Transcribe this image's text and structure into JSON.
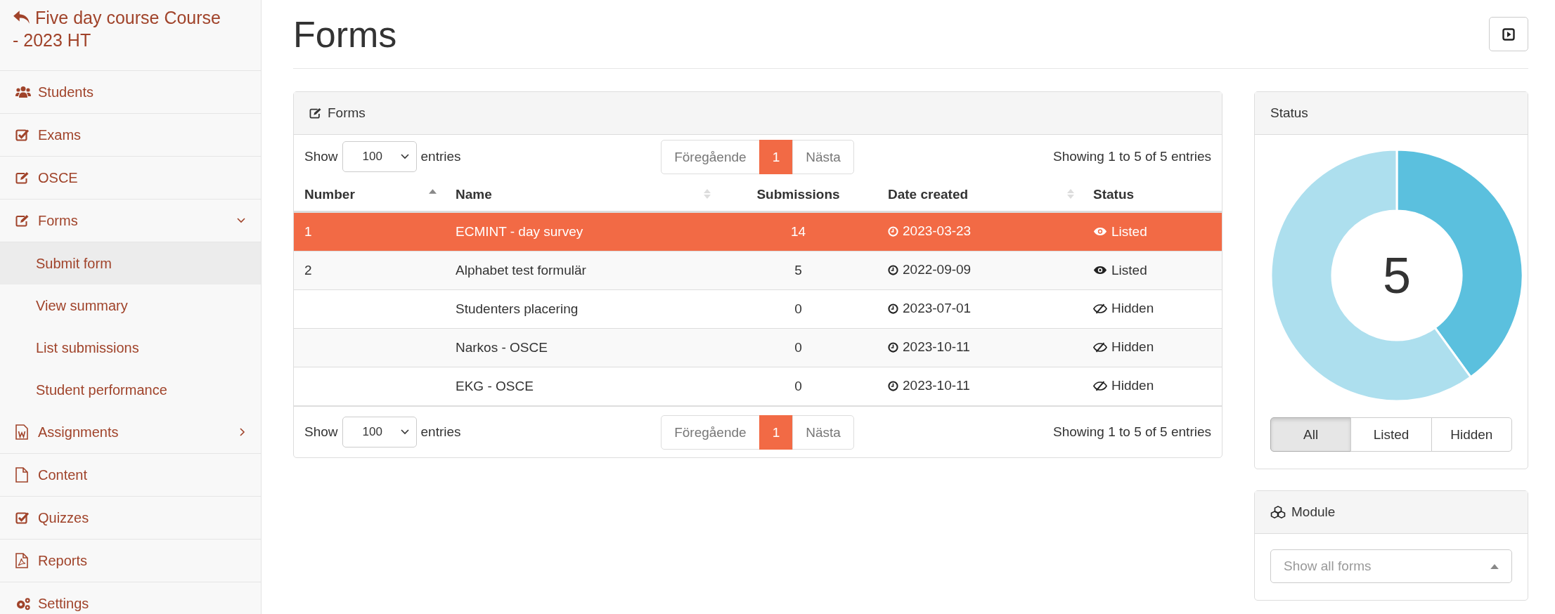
{
  "sidebar": {
    "back_title": "Five day course Course - 2023 HT",
    "items": [
      {
        "label": "Students",
        "kind": "users"
      },
      {
        "label": "Exams",
        "kind": "check"
      },
      {
        "label": "OSCE",
        "kind": "edit"
      },
      {
        "label": "Forms",
        "kind": "edit",
        "expanded": true,
        "children": [
          {
            "label": "Submit form",
            "selected": true
          },
          {
            "label": "View summary",
            "selected": false
          },
          {
            "label": "List submissions",
            "selected": false
          },
          {
            "label": "Student performance",
            "selected": false
          }
        ]
      },
      {
        "label": "Assignments",
        "kind": "word",
        "expanded": false
      },
      {
        "label": "Content",
        "kind": "file"
      },
      {
        "label": "Quizzes",
        "kind": "check"
      },
      {
        "label": "Reports",
        "kind": "pdf"
      },
      {
        "label": "Settings",
        "kind": "gears"
      }
    ]
  },
  "page": {
    "title": "Forms"
  },
  "forms_panel": {
    "title": "Forms",
    "top_controls": {
      "show_label": "Show",
      "page_size": "100",
      "entries_label": "entries",
      "pages": [
        {
          "label": "Föregående",
          "selected": false
        },
        {
          "label": "1",
          "selected": true
        },
        {
          "label": "Nästa",
          "selected": false
        }
      ],
      "info": "Showing 1 to 5 of 5 entries"
    },
    "columns": [
      {
        "label": "Number",
        "sortable": true,
        "sorted": true
      },
      {
        "label": "Name",
        "sortable": true,
        "sorted": false
      },
      {
        "label": "Submissions",
        "sortable": false
      },
      {
        "label": "Date created",
        "sortable": true,
        "sorted": false
      },
      {
        "label": "Status",
        "sortable": false
      }
    ],
    "rows": [
      {
        "number": "1",
        "name": "ECMINT - day survey",
        "submissions": "14",
        "date": "2023-03-23",
        "status": "Listed",
        "kind": "listed",
        "selected": true
      },
      {
        "number": "2",
        "name": "Alphabet test formulär",
        "submissions": "5",
        "date": "2022-09-09",
        "status": "Listed",
        "kind": "listed",
        "selected": false
      },
      {
        "name": "Studenters placering",
        "submissions": "0",
        "date": "2023-07-01",
        "status": "Hidden",
        "kind": "hidden",
        "selected": false
      },
      {
        "name": "Narkos - OSCE",
        "submissions": "0",
        "date": "2023-10-11",
        "status": "Hidden",
        "kind": "hidden",
        "selected": false
      },
      {
        "name": "EKG - OSCE",
        "submissions": "0",
        "date": "2023-10-11",
        "status": "Hidden",
        "kind": "hidden",
        "selected": false
      }
    ],
    "bottom_controls": {
      "show_label": "Show",
      "page_size": "100",
      "entries_label": "entries",
      "pages": [
        {
          "label": "Föregående",
          "selected": false
        },
        {
          "label": "1",
          "selected": true
        },
        {
          "label": "Nästa",
          "selected": false
        }
      ],
      "info": "Showing 1 to 5 of 5 entries"
    }
  },
  "status_panel": {
    "title": "Status",
    "total": "5",
    "filters": [
      {
        "label": "All",
        "selected": true
      },
      {
        "label": "Listed",
        "selected": false
      },
      {
        "label": "Hidden",
        "selected": false
      }
    ]
  },
  "module_panel": {
    "title": "Module",
    "select": {
      "placeholder": "Show all forms"
    }
  }
}
